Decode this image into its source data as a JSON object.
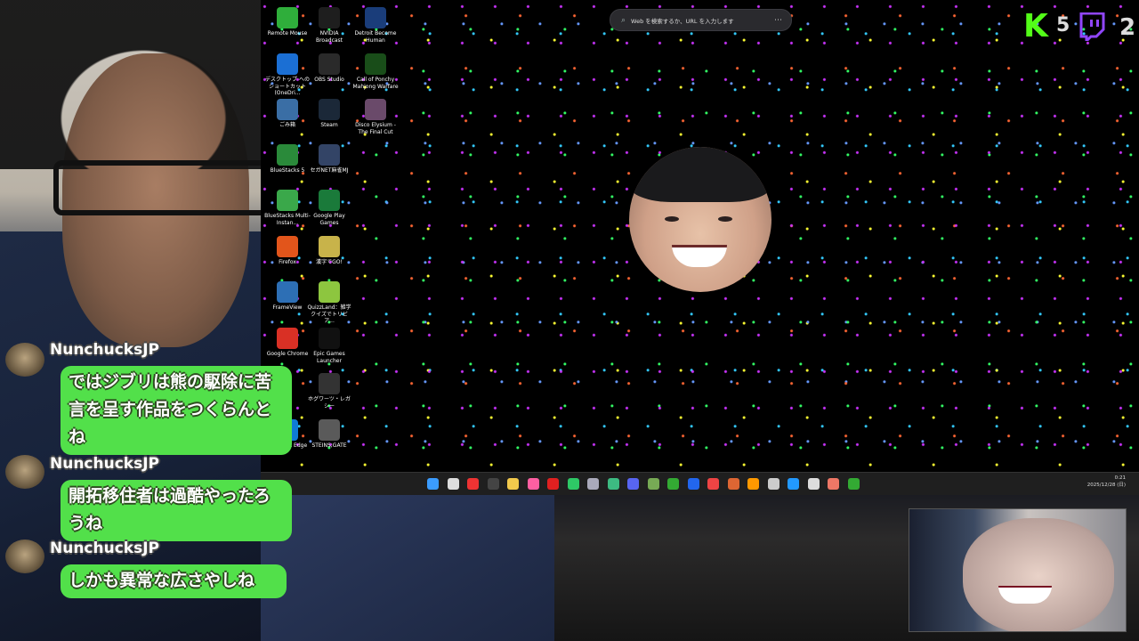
{
  "browser_search": {
    "placeholder": "Web を検索するか、URL を入力します"
  },
  "desktop_icons": [
    {
      "label": "Remote Mouse",
      "color": "#2fae3b"
    },
    {
      "label": "NVIDIA Broadcast",
      "color": "#1e1e1e"
    },
    {
      "label": "Detroit Become Human",
      "color": "#1a3d7a"
    },
    {
      "label": "デスクトップ へのショートカット (OneDri...",
      "color": "#1b6fd4"
    },
    {
      "label": "OBS Studio",
      "color": "#2a2a2a"
    },
    {
      "label": "Call of Ponchy Mahjong Warfare",
      "color": "#194d19"
    },
    {
      "label": "ごみ箱",
      "color": "#3a6ea5"
    },
    {
      "label": "Steam",
      "color": "#1b2838"
    },
    {
      "label": "Disco Elysium - The Final Cut",
      "color": "#6a4a6a"
    },
    {
      "label": "BlueStacks 5",
      "color": "#2a8a3a"
    },
    {
      "label": "セガNET麻雀MJ",
      "color": "#334466"
    },
    {
      "label": "BlueStacks Multi-Instan...",
      "color": "#3aa84a"
    },
    {
      "label": "Google Play Games",
      "color": "#1a7a3a"
    },
    {
      "label": "Firefox",
      "color": "#e2551b"
    },
    {
      "label": "漢字でGO!",
      "color": "#c8b34a"
    },
    {
      "label": "FrameView",
      "color": "#2d6fb5"
    },
    {
      "label": "QuizzLand：雑学クイズでトリビア...",
      "color": "#8dc63f"
    },
    {
      "label": "Google Chrome",
      "color": "#d93025"
    },
    {
      "label": "Epic Games Launcher",
      "color": "#111111"
    },
    {
      "label": "ホグワーツ・レガシー",
      "color": "#333333"
    },
    {
      "label": "Microsoft Edge",
      "color": "#0f7bd6"
    },
    {
      "label": "STEINS;GATE",
      "color": "#5a5a5a"
    }
  ],
  "counters": {
    "kick_logo": "K",
    "kick_count": "5",
    "twitch_count": "2"
  },
  "taskbar": {
    "time": "0:21",
    "date": "2025/12/28 (日)"
  },
  "chat": [
    {
      "user": "NunchucksJP",
      "text": "ではジブリは熊の駆除に苦言を呈す作品をつくらんとね"
    },
    {
      "user": "NunchucksJP",
      "text": "開拓移住者は過酷やったろうね"
    },
    {
      "user": "NunchucksJP",
      "text": "しかも異常な広さやしね"
    }
  ],
  "colors": {
    "chat_bubble": "#52e04a",
    "kick_green": "#53fc18",
    "twitch_purple": "#9146ff",
    "taskbar": "#1f1f1f"
  }
}
